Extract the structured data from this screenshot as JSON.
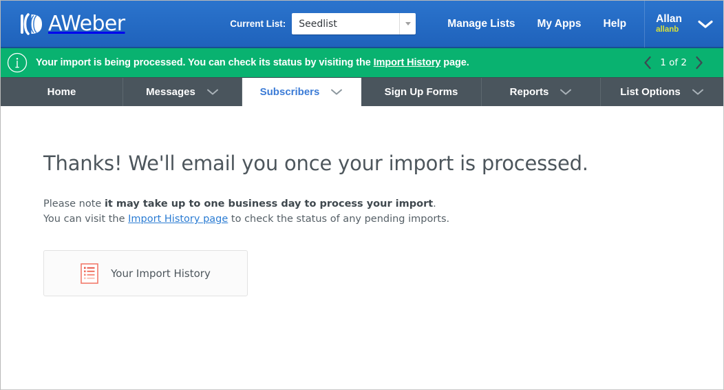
{
  "header": {
    "logo_text": "AWeber",
    "logo_icon": "aweber-logo-icon",
    "current_list_label": "Current List:",
    "current_list_value": "Seedlist",
    "dropdown_icon": "caret-down-icon",
    "nav": [
      {
        "label": "Manage Lists",
        "name": "manage-lists"
      },
      {
        "label": "My Apps",
        "name": "my-apps"
      },
      {
        "label": "Help",
        "name": "help"
      }
    ],
    "user": {
      "name": "Allan",
      "handle": "allanb",
      "chevron_icon": "chevron-down-icon"
    }
  },
  "banner": {
    "info_icon": "info-circle-icon",
    "text_before": "Your import is being processed. You can check its status by visiting the ",
    "link_text": "Import History",
    "text_after": " page.",
    "pager": {
      "prev_icon": "chevron-left-icon",
      "count": "1 of 2",
      "next_icon": "chevron-right-icon"
    }
  },
  "tabs": [
    {
      "label": "Home",
      "has_chevron": false,
      "active": false,
      "name": "home"
    },
    {
      "label": "Messages",
      "has_chevron": true,
      "active": false,
      "name": "messages"
    },
    {
      "label": "Subscribers",
      "has_chevron": true,
      "active": true,
      "name": "subscribers"
    },
    {
      "label": "Sign Up Forms",
      "has_chevron": false,
      "active": false,
      "name": "sign-up-forms"
    },
    {
      "label": "Reports",
      "has_chevron": true,
      "active": false,
      "name": "reports"
    },
    {
      "label": "List Options",
      "has_chevron": true,
      "active": false,
      "name": "list-options"
    }
  ],
  "main": {
    "title": "Thanks! We'll email you once your import is processed.",
    "note_prefix": "Please note ",
    "note_bold": "it may take up to one business day to process your import",
    "note_suffix": ".",
    "line2_prefix": "You can visit the ",
    "line2_link": "Import History page",
    "line2_suffix": " to check the status of any pending imports.",
    "card": {
      "label": "Your Import History",
      "icon": "import-history-document-icon"
    }
  },
  "colors": {
    "header_blue": "#2b74cd",
    "banner_green": "#09b270",
    "tabbar_slate": "#4a555d",
    "active_tab_blue": "#3b7bd6",
    "link_blue": "#2b7cd3",
    "handle_yellow": "#d7e03a",
    "icon_coral": "#f08070"
  }
}
